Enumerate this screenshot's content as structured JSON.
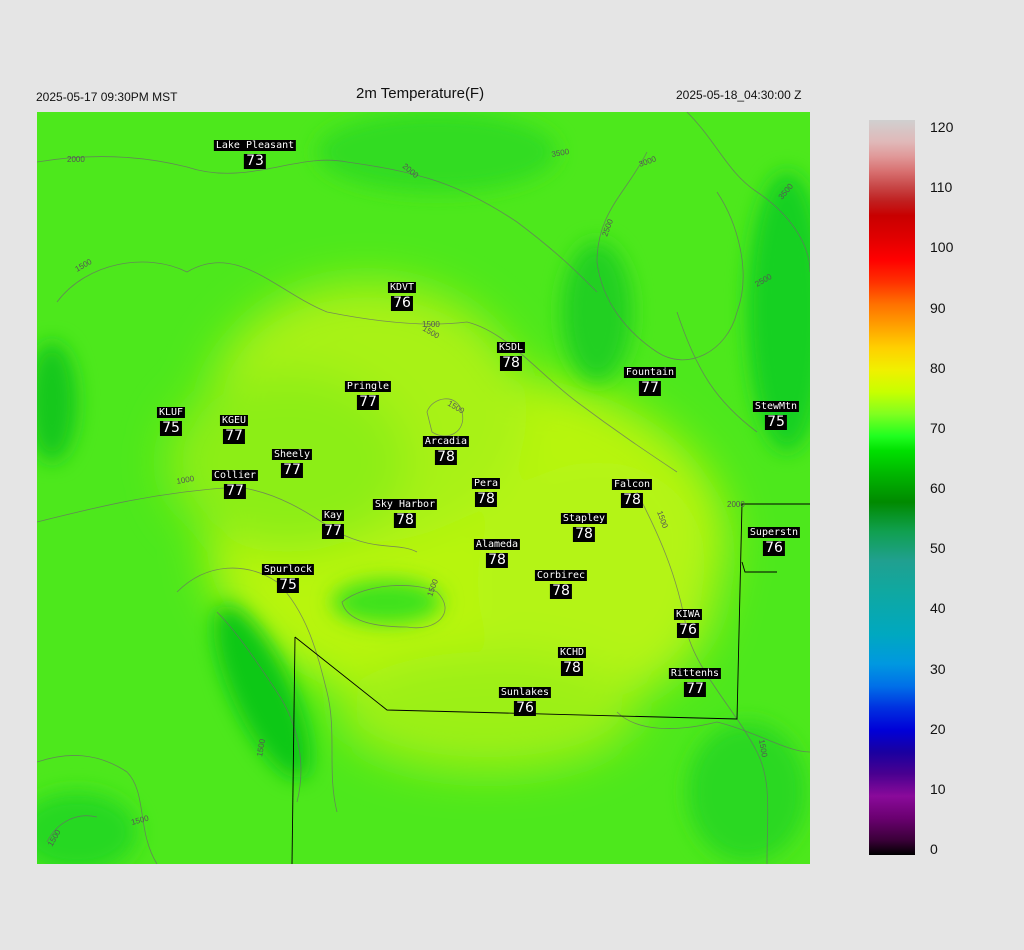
{
  "header": {
    "local_time": "2025-05-17 09:30PM MST",
    "title": "2m Temperature(F)",
    "utc_time": "2025-05-18_04:30:00 Z"
  },
  "map": {
    "field": "2m temperature",
    "units": "F",
    "base_color": "#52e81a",
    "warm_color": "#b4f510",
    "cool_color": "#20e020",
    "contour_labels": [
      "2000",
      "1500",
      "1000",
      "1500",
      "2000",
      "2500",
      "3000",
      "3500",
      "3500",
      "2500",
      "1500",
      "1500",
      "2000",
      "1500",
      "1500",
      "1500",
      "1500",
      "1500",
      "1500"
    ]
  },
  "stations": [
    {
      "name": "Lake Pleasant",
      "temp": "73"
    },
    {
      "name": "KDVT",
      "temp": "76"
    },
    {
      "name": "KSDL",
      "temp": "78"
    },
    {
      "name": "Fountain",
      "temp": "77"
    },
    {
      "name": "StewMtn",
      "temp": "75"
    },
    {
      "name": "Pringle",
      "temp": "77"
    },
    {
      "name": "KLUF",
      "temp": "75"
    },
    {
      "name": "KGEU",
      "temp": "77"
    },
    {
      "name": "Arcadia",
      "temp": "78"
    },
    {
      "name": "Sheely",
      "temp": "77"
    },
    {
      "name": "Collier",
      "temp": "77"
    },
    {
      "name": "Pera",
      "temp": "78"
    },
    {
      "name": "Falcon",
      "temp": "78"
    },
    {
      "name": "Kay",
      "temp": "77"
    },
    {
      "name": "Sky Harbor",
      "temp": "78"
    },
    {
      "name": "Stapley",
      "temp": "78"
    },
    {
      "name": "Superstn",
      "temp": "76"
    },
    {
      "name": "Alameda",
      "temp": "78"
    },
    {
      "name": "Spurlock",
      "temp": "75"
    },
    {
      "name": "Corbirec",
      "temp": "78"
    },
    {
      "name": "KIWA",
      "temp": "76"
    },
    {
      "name": "KCHD",
      "temp": "78"
    },
    {
      "name": "Rittenhs",
      "temp": "77"
    },
    {
      "name": "Sunlakes",
      "temp": "76"
    }
  ],
  "colorbar": {
    "ticks": [
      "120",
      "110",
      "100",
      "90",
      "80",
      "70",
      "60",
      "50",
      "40",
      "30",
      "20",
      "10",
      "0"
    ],
    "min": 0,
    "max": 120
  }
}
